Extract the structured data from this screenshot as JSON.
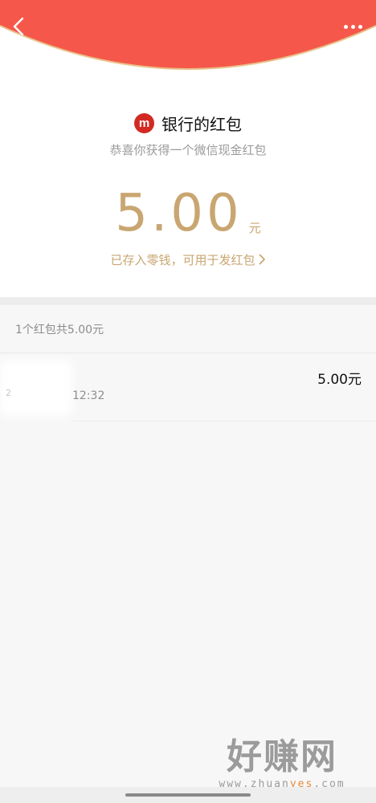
{
  "header": {
    "accent_color": "#f5584a",
    "border_color": "#e9c38d",
    "back_icon": "chevron-left-icon",
    "more_icon": "more-dots-icon"
  },
  "sender": {
    "logo_letter": "m",
    "logo_color": "#d22a22",
    "name": "银行的红包"
  },
  "subtitle": "恭喜你获得一个微信现金红包",
  "amount": {
    "value": "5.00",
    "unit": "元",
    "color": "#c9a671"
  },
  "saved_link": {
    "label": "已存入零钱，可用于发红包"
  },
  "list": {
    "summary": "1个红包共5.00元",
    "items": [
      {
        "name_mark": "2",
        "time": "12:32",
        "amount": "5.00元"
      }
    ]
  },
  "watermark": {
    "main": "好赚网",
    "url_prefix": "www.zhuan",
    "url_highlight": "yes",
    "url_suffix": ".com"
  }
}
